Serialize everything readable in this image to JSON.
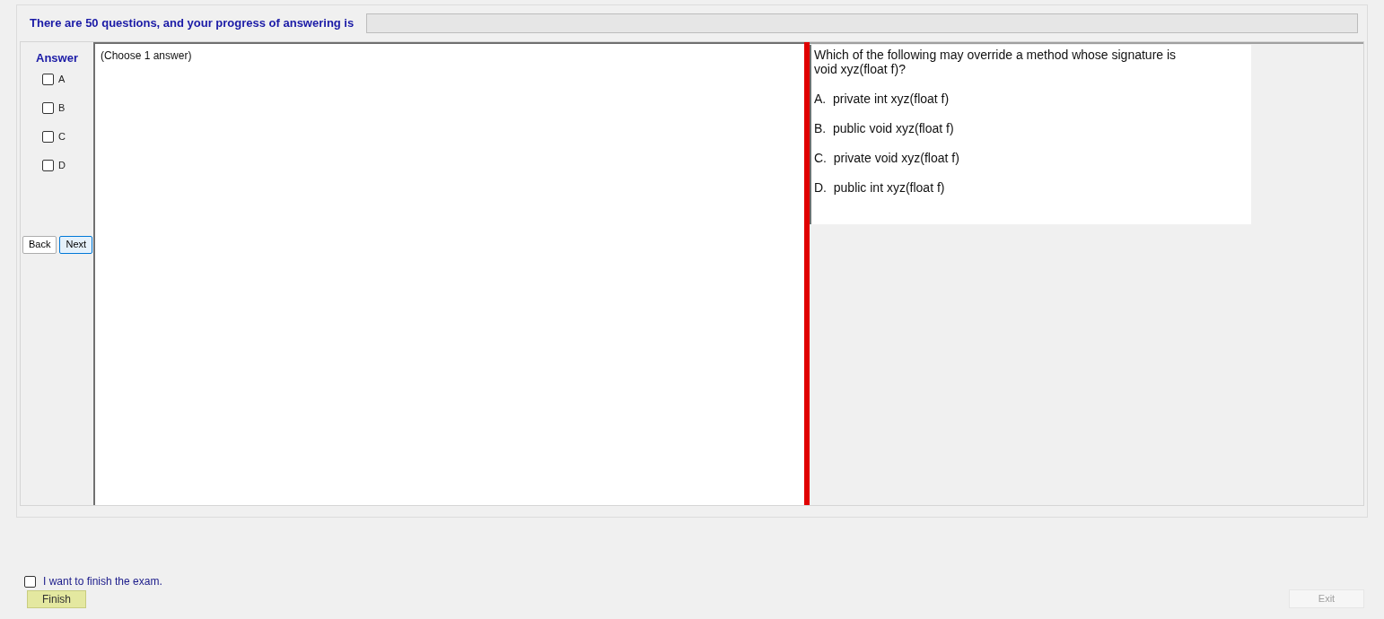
{
  "header": {
    "text": "There are 50 questions, and your progress of answering is",
    "progress": {
      "level": 0
    }
  },
  "answer": {
    "title": "Answer",
    "options": [
      {
        "label": "A",
        "checked": false
      },
      {
        "label": "B",
        "checked": false
      },
      {
        "label": "C",
        "checked": false
      },
      {
        "label": "D",
        "checked": false
      }
    ]
  },
  "nav_buttons": [
    {
      "label": "Back",
      "selected": false
    },
    {
      "label": "Next",
      "selected": true
    }
  ],
  "answer_box": {
    "value": "(Choose 1 answer)"
  },
  "question": {
    "lines": [
      "Which of the following may override a method whose signature is",
      "void xyz(float f)?"
    ],
    "choices": [
      "A.  private int xyz(float f)",
      "B.  public void xyz(float f)",
      "C.  private void xyz(float f)",
      "D.  public int xyz(float f)"
    ]
  },
  "finish": {
    "checkbox": {
      "label": "I want to finish the exam.",
      "checked": false
    },
    "button": {
      "label": "Finish",
      "disabled": false
    }
  },
  "exit_button": {
    "label": "Exit",
    "disabled": true
  }
}
